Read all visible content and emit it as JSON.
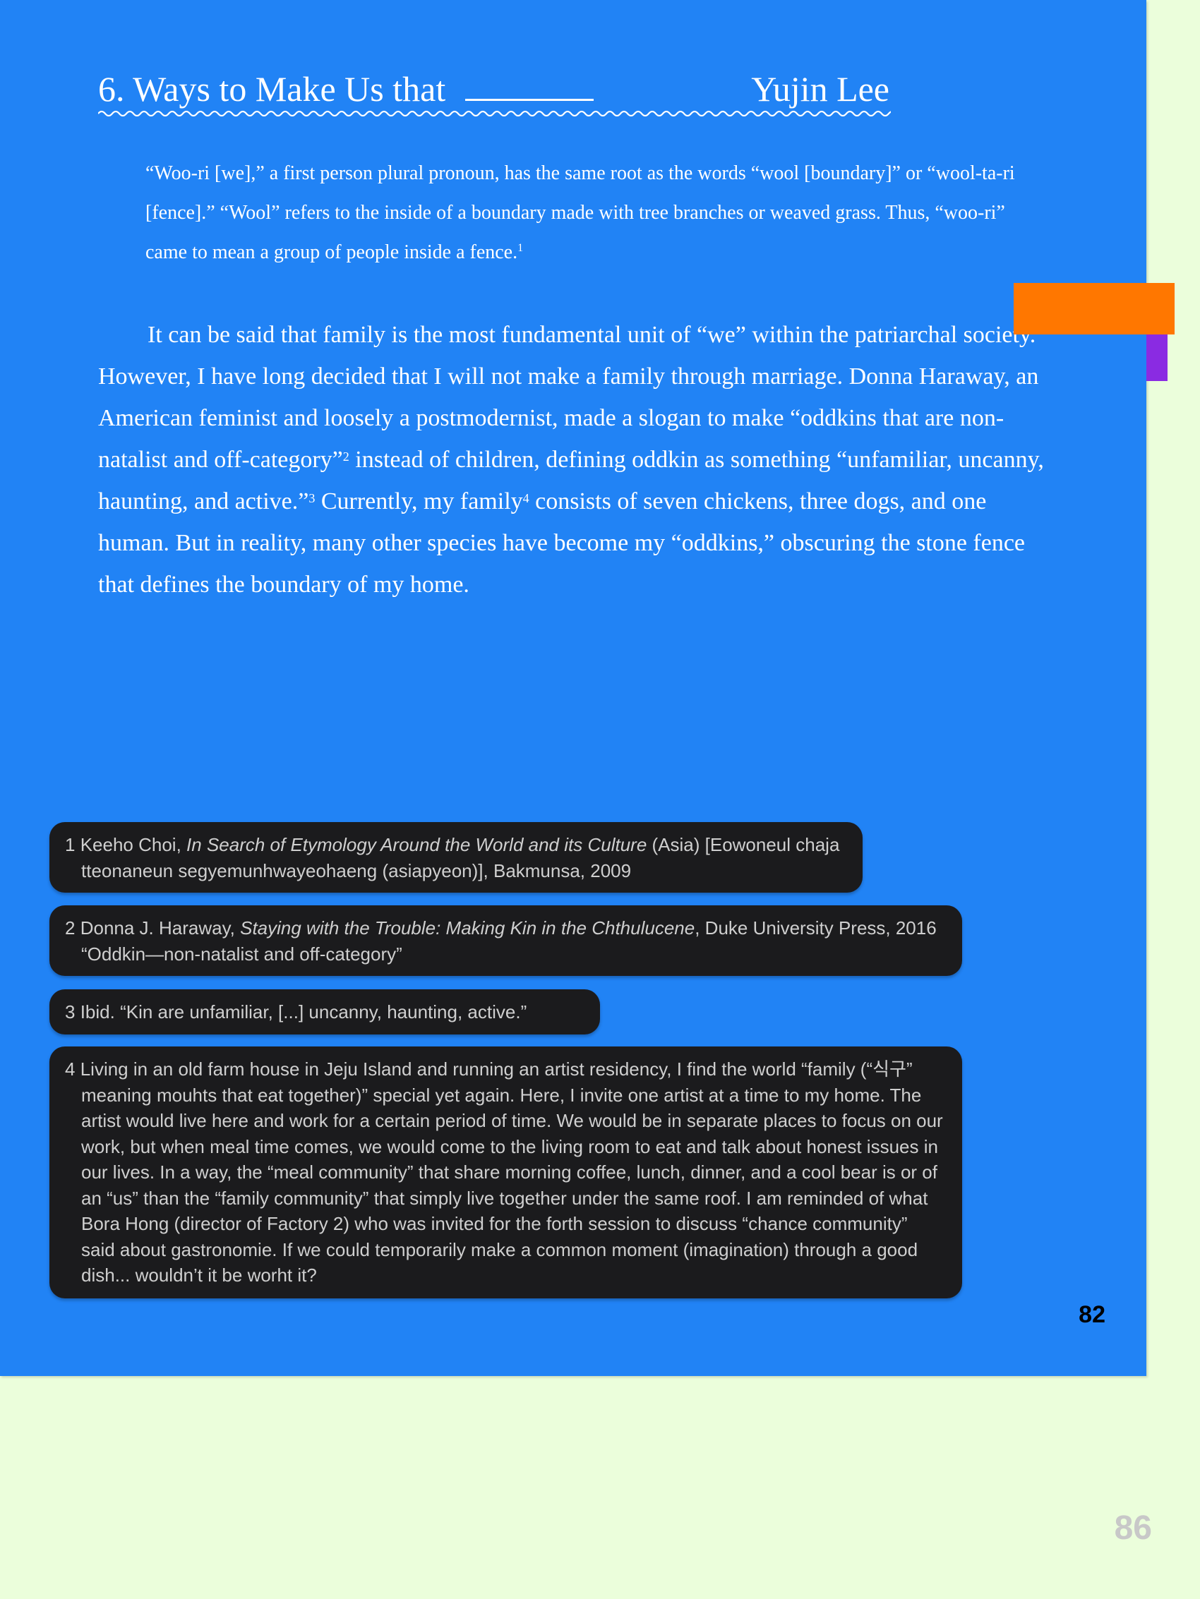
{
  "title": {
    "text": "6. Ways to Make Us that",
    "author": "Yujin Lee"
  },
  "epigraph": {
    "text": "“Woo-ri [we],” a first person plural pronoun, has the same root as the words “wool [boundary]” or “wool-ta-ri [fence].” “Wool” refers to the inside of a boundary made with tree branches or weaved grass. Thus, “woo-ri” came to mean a group of people inside a fence.",
    "footnote_marker": "1"
  },
  "body": {
    "part1": "It can be said that family is the most fundamental unit of “we” within the patriarchal society. However, I have long decided that I will not make a family through marriage. Donna Haraway, an American feminist and loosely a postmodernist, made a slogan to make “oddkins that are non-natalist and off-category”",
    "marker1": "2",
    "part2": " instead of children, defining oddkin as something “unfamiliar, uncanny, haunting, and active.”",
    "marker2": "3",
    "part3": " Currently, my family",
    "marker3": "4",
    "part4": " consists of seven chickens, three dogs, and one human. But in reality, many other species have become my “oddkins,” obscuring the stone fence that defines the boundary of my home."
  },
  "footnotes": [
    {
      "number": "1",
      "prefix": "Keeho Choi, ",
      "italic": "In Search of Etymology Around the World and its Culture",
      "suffix": " (Asia) [Eowoneul chaja tteonaneun segyemunhwayeohaeng (asiapyeon)], Bakmunsa, 2009"
    },
    {
      "number": "2",
      "prefix": "Donna J. Haraway, ",
      "italic": "Staying with the Trouble: Making Kin in the Chthulucene",
      "suffix": ", Duke University Press, 2016 “Oddkin—non-natalist and off-category”"
    },
    {
      "number": "3",
      "prefix": "Ibid. “Kin are unfamiliar, [...] uncanny, haunting, active.”",
      "italic": "",
      "suffix": ""
    },
    {
      "number": "4",
      "prefix": "Living in an old farm house in Jeju Island and running an artist residency, I find the world “family (“식구” meaning mouhts that eat together)” special yet again. Here, I invite one artist at a time to my home. The artist would live here and work for a certain period of time. We would be in separate places to focus on our work, but when meal time comes, we would come to the living room to eat and talk about honest issues in our lives. In a way, the “meal community” that share morning coffee, lunch, dinner, and a cool bear is or of an “us” than the “family community” that simply live together under the same roof. I am reminded of what Bora Hong (director of Factory 2) who was invited for the forth session to discuss “chance community” said about gastronomie. If we could temporarily make a common moment (imagination) through a good dish... wouldn’t it be worht it?",
      "italic": "",
      "suffix": ""
    }
  ],
  "page_number": "82",
  "outer_page_number": "86",
  "colors": {
    "page_background": "#2183f5",
    "outer_background": "#ebfedb",
    "footnote_box": "#1b1b1d",
    "tab_orange": "#ff7700",
    "tab_purple": "#8a2be2"
  }
}
